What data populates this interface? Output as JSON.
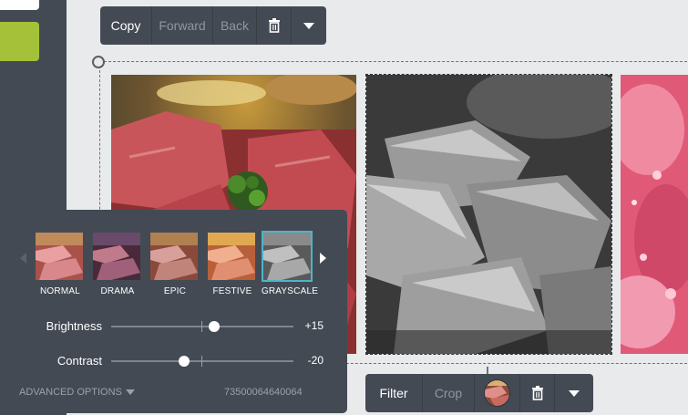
{
  "toolbar_top": {
    "copy_label": "Copy",
    "forward_label": "Forward",
    "back_label": "Back",
    "delete_icon": "trash-icon",
    "more_icon": "caret-down-icon"
  },
  "toolbar_bottom": {
    "filter_label": "Filter",
    "crop_label": "Crop",
    "thumbnail_icon": "image-thumbnail",
    "delete_icon": "trash-icon",
    "more_icon": "caret-down-icon"
  },
  "filter_panel": {
    "filters": [
      {
        "label": "NORMAL"
      },
      {
        "label": "DRAMA"
      },
      {
        "label": "EPIC"
      },
      {
        "label": "FESTIVE"
      },
      {
        "label": "GRAYSCALE",
        "selected": true
      }
    ],
    "brightness": {
      "label": "Brightness",
      "value": "+15"
    },
    "contrast": {
      "label": "Contrast",
      "value": "-20"
    },
    "advanced_label": "ADVANCED OPTIONS",
    "id_text": "73500064640064"
  },
  "colors": {
    "panel_bg": "#434a54",
    "accent_green": "#a5c13a",
    "selection_border": "#4fb3c8"
  }
}
